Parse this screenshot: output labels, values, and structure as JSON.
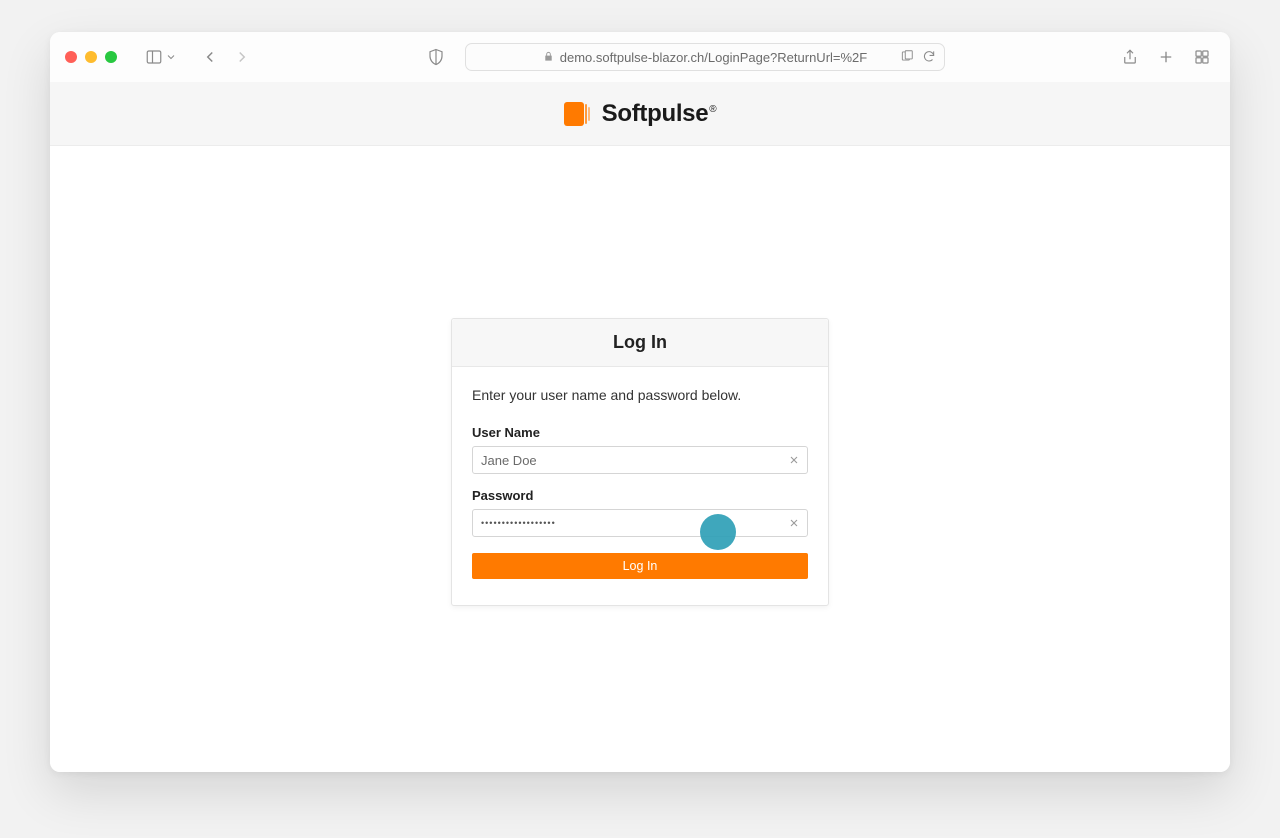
{
  "browser": {
    "url": "demo.softpulse-blazor.ch/LoginPage?ReturnUrl=%2F"
  },
  "header": {
    "brand_name": "Softpulse",
    "brand_suffix": "®"
  },
  "login": {
    "title": "Log In",
    "instruction": "Enter your user name and password below.",
    "username_label": "User Name",
    "username_value": "Jane Doe",
    "password_label": "Password",
    "password_value": "••••••••••••••••••",
    "submit_label": "Log In"
  },
  "colors": {
    "accent": "#ff7a00"
  }
}
